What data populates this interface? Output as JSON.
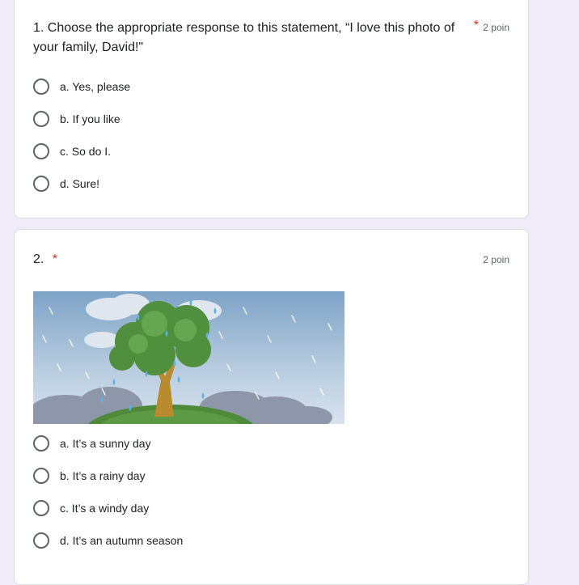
{
  "questions": [
    {
      "title": "1. Choose the appropriate response to this statement, “I love this photo of your family, David!\"",
      "required_mark": "*",
      "points": "2 poin",
      "options": [
        "a. Yes, please",
        "b. If you like",
        "c. So do I.",
        "d. Sure!"
      ]
    },
    {
      "title": "2.",
      "required_mark": "*",
      "points": "2 poin",
      "image": "tree-in-rain-illustration",
      "options": [
        "a. It’s a sunny day",
        "b. It’s a rainy day",
        "c. It’s a windy day",
        "d. It’s an autumn season"
      ]
    }
  ],
  "colors": {
    "background": "#f0ebf8",
    "required": "#d93025",
    "radio_border": "#5f6368"
  }
}
